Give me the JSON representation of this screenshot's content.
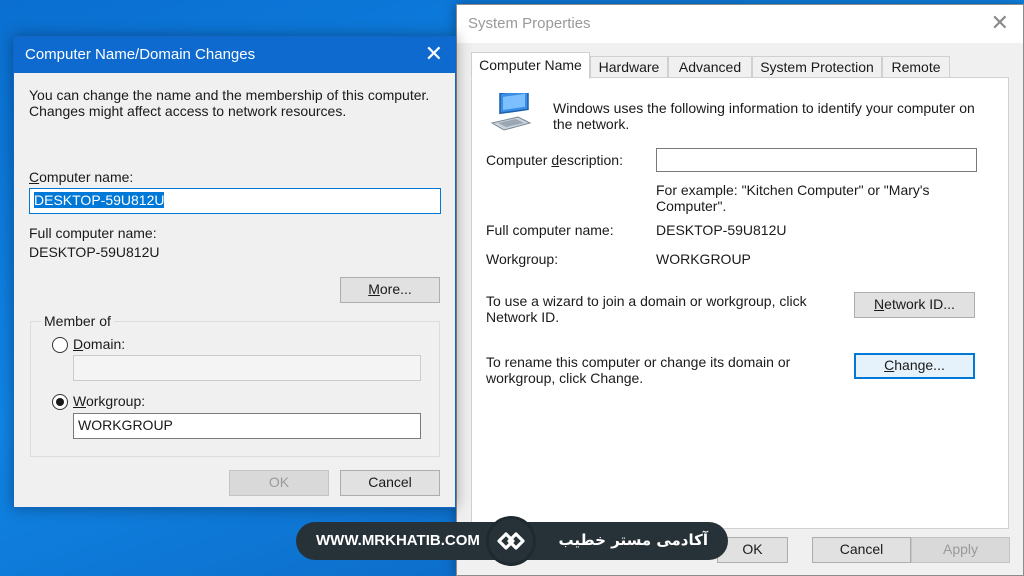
{
  "system_properties": {
    "title": "System Properties",
    "close_glyph": "✕",
    "tabs": [
      "Computer Name",
      "Hardware",
      "Advanced",
      "System Protection",
      "Remote"
    ],
    "info_text": "Windows uses the following information to identify your computer on the network.",
    "computer_description_label_pre": "Computer ",
    "computer_description_label_u": "d",
    "computer_description_label_post": "escription:",
    "computer_description_value": "",
    "example_text": "For example: \"Kitchen Computer\" or \"Mary's Computer\".",
    "full_name_label": "Full computer name:",
    "full_name_value": "DESKTOP-59U812U",
    "workgroup_label": "Workgroup:",
    "workgroup_value": "WORKGROUP",
    "wizard_text": "To use a wizard to join a domain or workgroup, click Network ID.",
    "network_id_u": "N",
    "network_id_rest": "etwork ID...",
    "rename_text": "To rename this computer or change its domain or workgroup, click Change.",
    "change_u": "C",
    "change_rest": "hange...",
    "ok_label": "OK",
    "cancel_label": "Cancel",
    "apply_label": "Apply"
  },
  "name_dialog": {
    "title": "Computer Name/Domain Changes",
    "close_glyph": "✕",
    "intro_text": "You can change the name and the membership of this computer. Changes might affect access to network resources.",
    "computer_name_u": "C",
    "computer_name_rest": "omputer name:",
    "computer_name_value": "DESKTOP-59U812U",
    "full_name_label": "Full computer name:",
    "full_name_value": "DESKTOP-59U812U",
    "more_u": "M",
    "more_rest": "ore...",
    "member_of_label": "Member of",
    "domain_u": "D",
    "domain_rest": "omain:",
    "domain_value": "",
    "workgroup_u": "W",
    "workgroup_rest": "orkgroup:",
    "workgroup_value": "WORKGROUP",
    "selected_option": "Workgroup",
    "ok_label": "OK",
    "cancel_label": "Cancel"
  },
  "brand": {
    "url": "WWW.MRKHATIB.COM",
    "name_fa": "آکادمی مستر خطیب"
  },
  "colors": {
    "accent": "#0078d7",
    "dialog_titlebar": "#0f6ad0",
    "desktop": "#0a6fd0"
  }
}
